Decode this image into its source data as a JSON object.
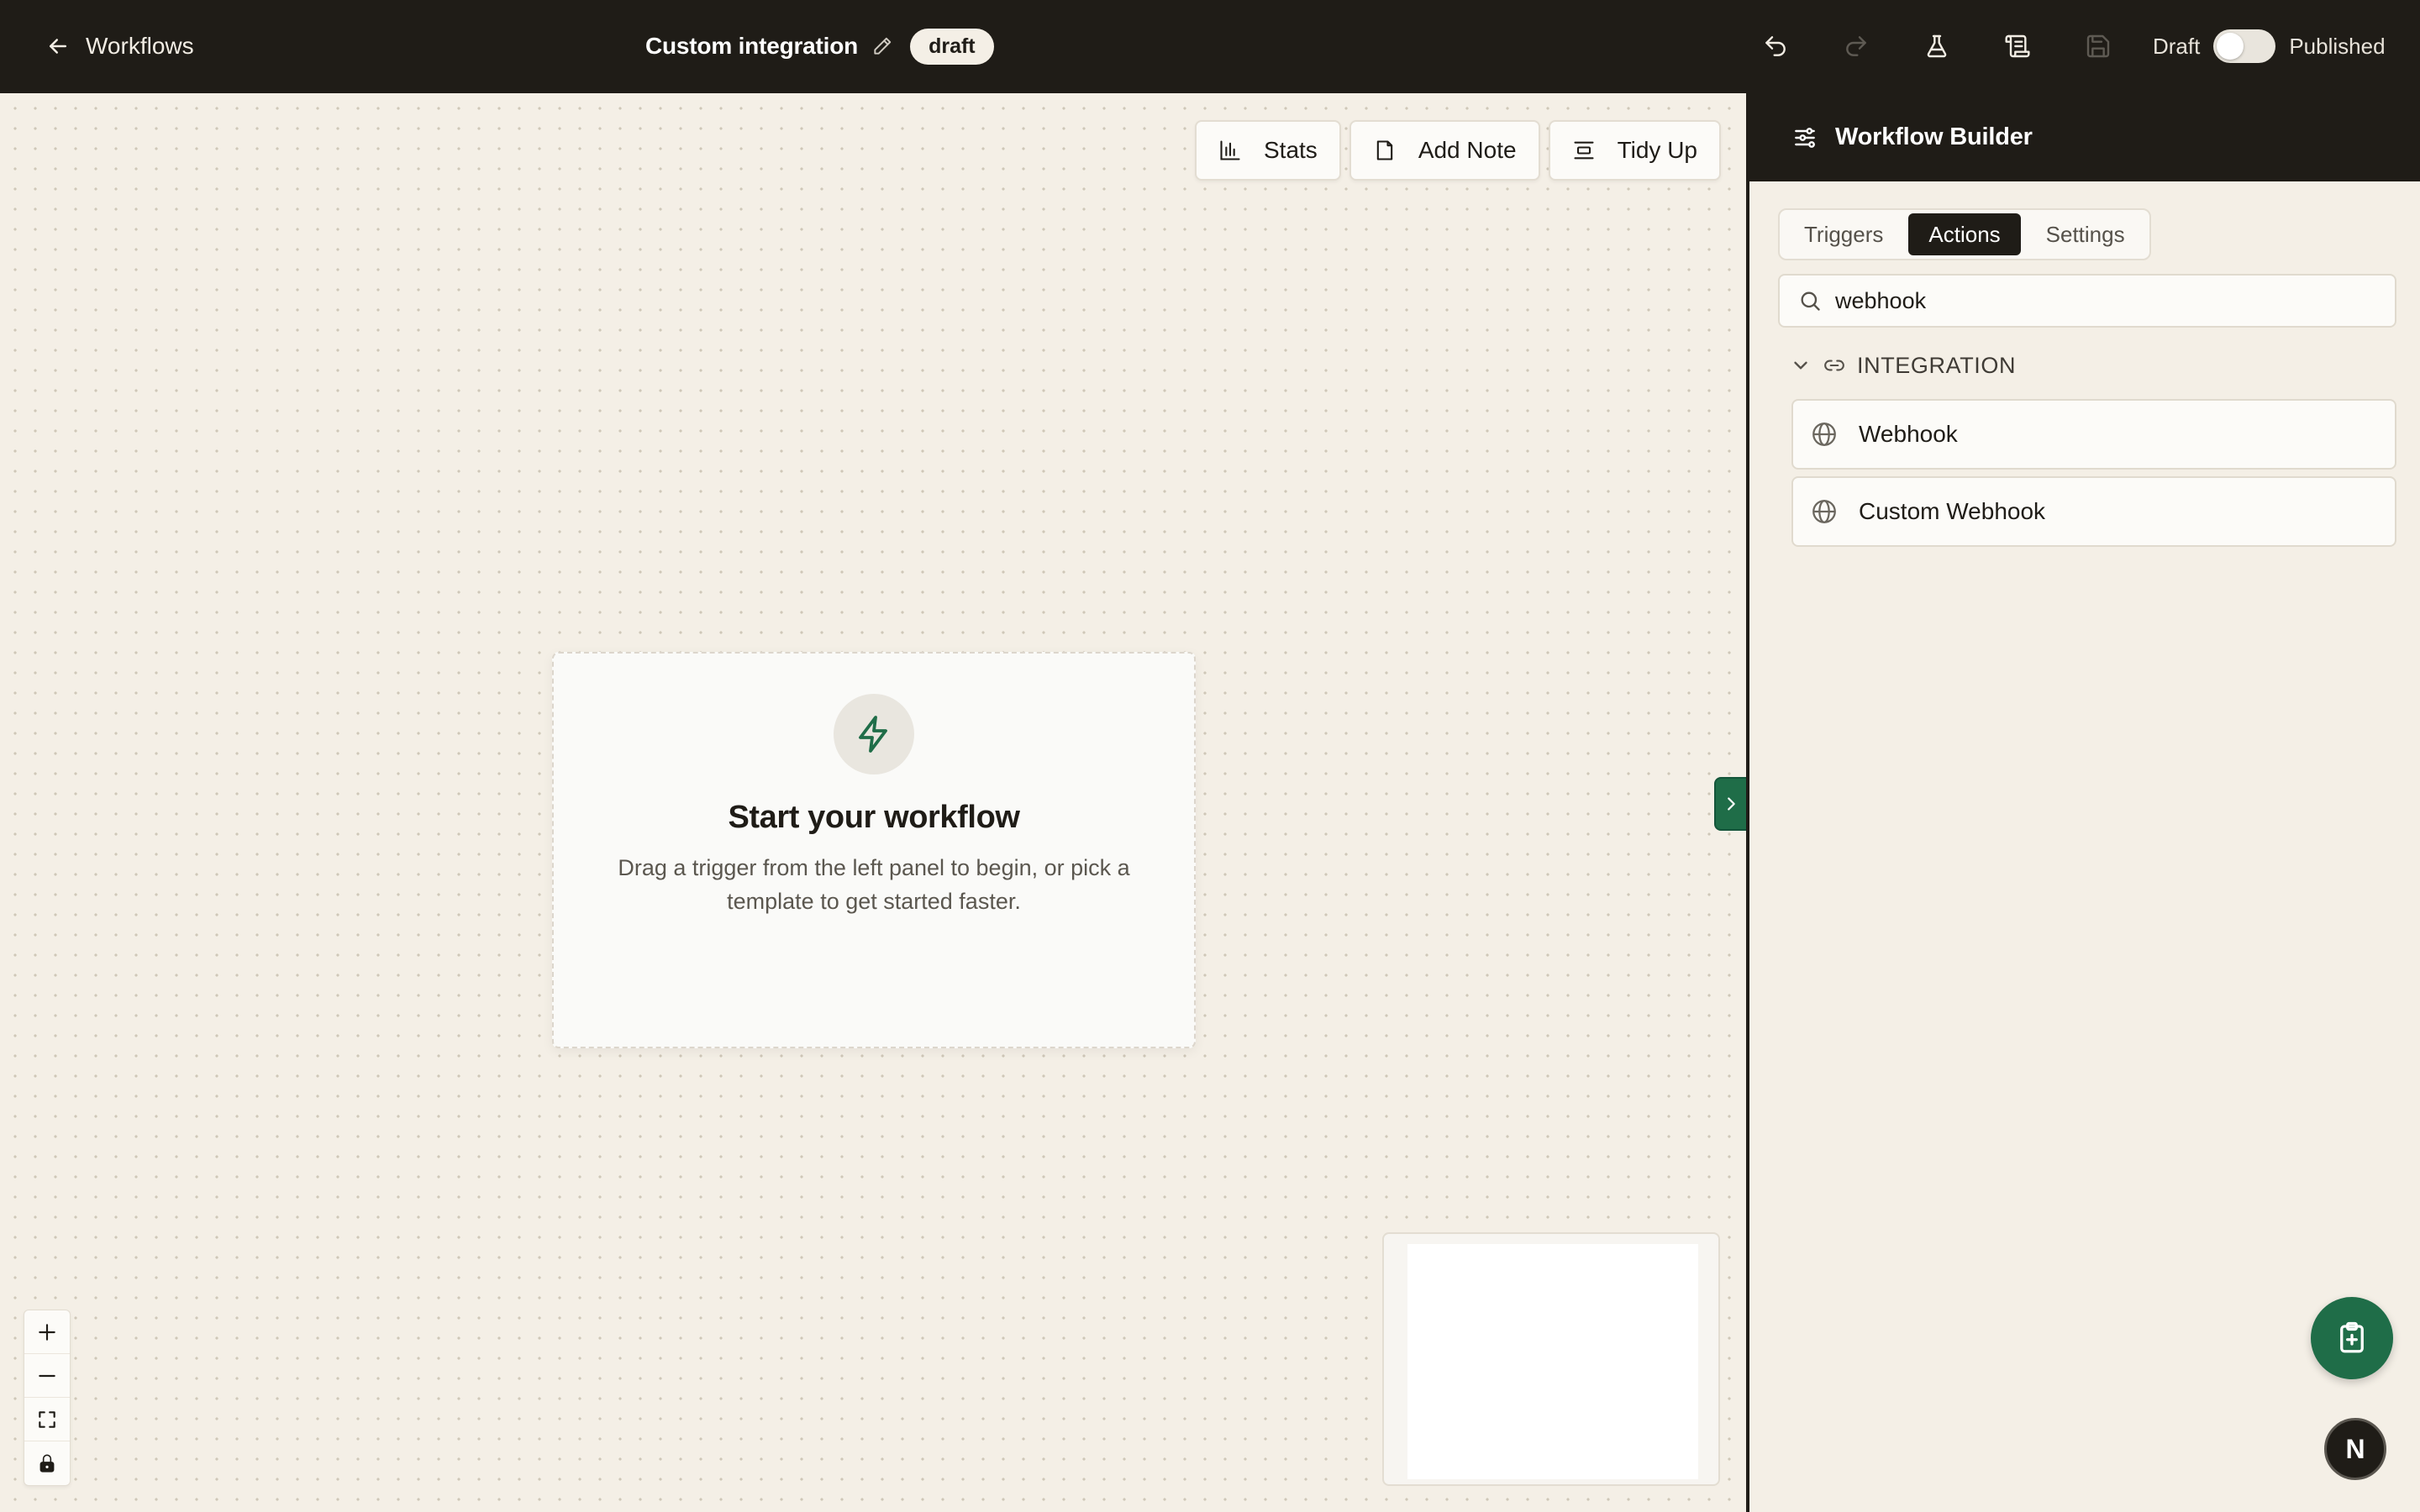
{
  "topbar": {
    "back_label": "Workflows",
    "workflow_title": "Custom integration",
    "status_badge": "draft",
    "toggle_left_label": "Draft",
    "toggle_right_label": "Published",
    "published": false
  },
  "canvas": {
    "toolbar": {
      "stats_label": "Stats",
      "add_note_label": "Add Note",
      "tidy_up_label": "Tidy Up"
    },
    "empty_state": {
      "icon": "lightning-icon",
      "title": "Start your workflow",
      "description": "Drag a trigger from the left panel to begin, or pick a template to get started faster."
    }
  },
  "panel": {
    "title": "Workflow Builder",
    "tabs": [
      {
        "label": "Triggers",
        "active": false
      },
      {
        "label": "Actions",
        "active": true
      },
      {
        "label": "Settings",
        "active": false
      }
    ],
    "search": {
      "value": "webhook",
      "placeholder": ""
    },
    "group": {
      "label": "INTEGRATION",
      "expanded": true,
      "items": [
        {
          "label": "Webhook",
          "icon": "globe-icon"
        },
        {
          "label": "Custom Webhook",
          "icon": "globe-icon"
        }
      ]
    }
  },
  "avatar": {
    "initial": "N"
  },
  "colors": {
    "topbar_bg": "#1f1c17",
    "canvas_bg": "#f4efe6",
    "accent_green": "#1f6d48"
  }
}
